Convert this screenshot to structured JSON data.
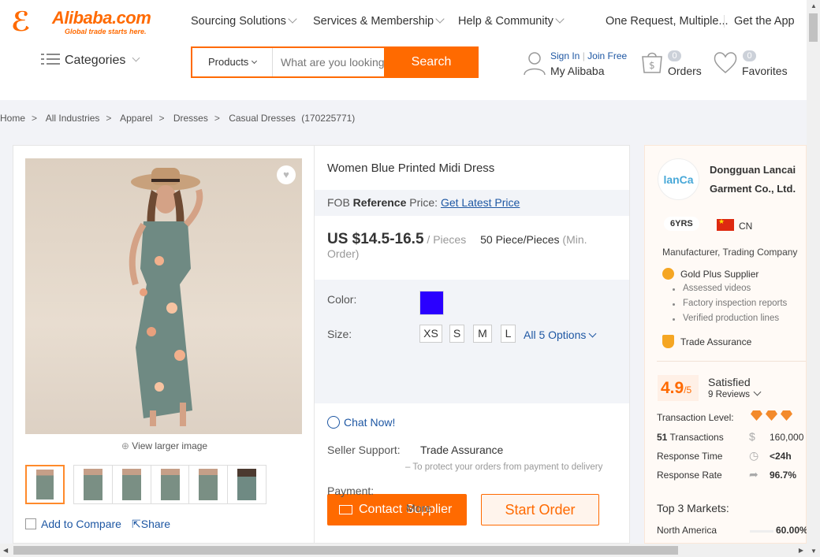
{
  "header": {
    "logo_text": "Alibaba.com",
    "logo_tagline": "Global trade starts here.",
    "nav": [
      "Sourcing Solutions",
      "Services & Membership",
      "Help & Community"
    ],
    "one_request": "One Request, Multiple...",
    "get_app": "Get the App",
    "categories": "Categories",
    "search_scope": "Products",
    "search_placeholder": "What are you looking for...",
    "search_button": "Search",
    "sign_in": "Sign In",
    "join_free": "Join Free",
    "my_alibaba": "My Alibaba",
    "orders_count": "0",
    "orders_label": "Orders",
    "favorites_count": "0",
    "favorites_label": "Favorites"
  },
  "breadcrumb": [
    "Home",
    "All Industries",
    "Apparel",
    "Dresses",
    "Casual Dresses"
  ],
  "breadcrumb_id": "(170225771)",
  "gallery": {
    "view_larger": "View larger image",
    "add_to_compare": "Add to Compare",
    "share": "Share",
    "thumbnail_count": 6
  },
  "product": {
    "title": "Women Blue Printed Midi Dress",
    "fob_prefix": "FOB",
    "fob_bold": "Reference",
    "fob_suffix": "Price:",
    "get_latest_price": "Get Latest Price",
    "price": "US $14.5-16.5",
    "price_unit": "/ Pieces",
    "moq": "50 Piece/Pieces",
    "moq_note": "(Min. Order)",
    "color_label": "Color:",
    "color_swatch": "#2a00ff",
    "size_label": "Size:",
    "sizes": [
      "XS",
      "S",
      "M",
      "L"
    ],
    "all_options": "All 5 Options",
    "contact_supplier": "Contact Supplier",
    "start_order": "Start Order",
    "chat_now": "Chat Now!",
    "seller_support_label": "Seller Support:",
    "trade_assurance": "Trade Assurance",
    "trade_assurance_note": "– To protect your orders from payment to delivery",
    "payment_label": "Payment:",
    "more": "More"
  },
  "supplier": {
    "logo_text": "lanCa",
    "name": "Dongguan Lancai Garment Co., Ltd.",
    "years": "6YRS",
    "country": "CN",
    "business_type": "Manufacturer, Trading Company",
    "gold_plus": "Gold Plus Supplier",
    "features": [
      "Assessed videos",
      "Factory inspection reports",
      "Verified production lines"
    ],
    "trade_assurance": "Trade Assurance",
    "rating": "4.9",
    "rating_max": "/5",
    "satisfaction": "Satisfied",
    "reviews": "9 Reviews",
    "transaction_level_label": "Transaction Level:",
    "transactions_count": "51",
    "transactions_label": "Transactions",
    "transactions_value": "160,000+",
    "response_time_label": "Response Time",
    "response_time_value": "<24h",
    "response_rate_label": "Response Rate",
    "response_rate_value": "96.7%",
    "top_markets_label": "Top 3 Markets:",
    "market_1_name": "North America",
    "market_1_value": "60.00%"
  },
  "colors": {
    "accent": "#ff6a00",
    "link": "#1e57a3"
  }
}
